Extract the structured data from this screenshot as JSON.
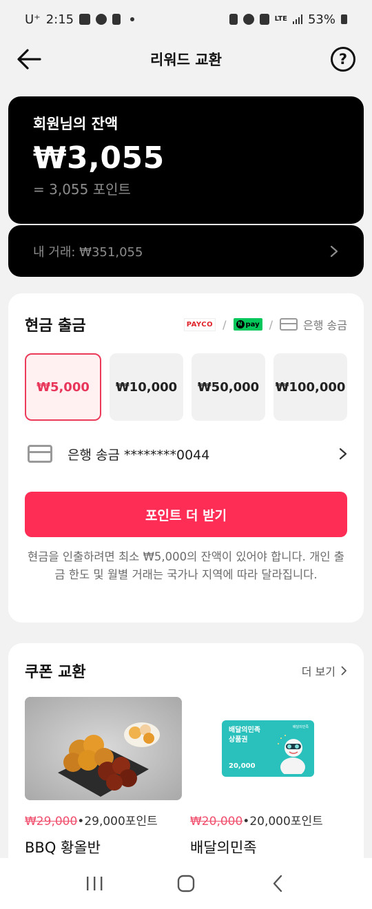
{
  "status_bar": {
    "carrier": "U⁺",
    "time": "2:15",
    "battery": "53%",
    "network": "LTE"
  },
  "header": {
    "title": "리워드 교환",
    "help_icon": "?"
  },
  "balance": {
    "label": "회원님의 잔액",
    "amount": "₩3,055",
    "points": "= 3,055 포인트",
    "transactions": "내 거래: ₩351,055"
  },
  "cash_withdrawal": {
    "title": "현금 출금",
    "methods": {
      "payco": "PAYCO",
      "npay": "pay",
      "bank": "은행 송금"
    },
    "amounts": [
      "₩5,000",
      "₩10,000",
      "₩50,000",
      "₩100,000"
    ],
    "selected_index": 0,
    "bank_account": "은행 송금 ********0044",
    "cta_label": "포인트 더 받기",
    "notice": "현금을 인출하려면 최소 ₩5,000의 잔액이 있어야 합니다. 개인 출금 한도 및 월별 거래는 국가나 지역에 따라 달라집니다."
  },
  "coupons": {
    "title": "쿠폰 교환",
    "more_label": "더 보기",
    "items": [
      {
        "old_price": "₩29,000",
        "price": "•29,000포인트",
        "name": "BBQ 황올반"
      },
      {
        "old_price": "₩20,000",
        "price": "•20,000포인트",
        "name": "배달의민족"
      }
    ],
    "baemin_card": {
      "brand": "배달의민족",
      "line1": "배달의민족",
      "line2": "상품권",
      "value": "20,000"
    }
  },
  "colors": {
    "accent": "#fd2d55",
    "card_dark": "#000000",
    "baemin_teal": "#2ac1bc"
  }
}
